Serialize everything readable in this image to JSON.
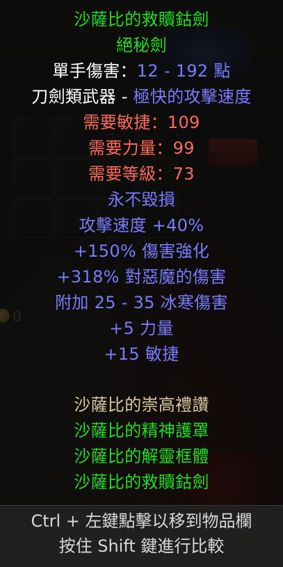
{
  "background": {
    "gold_count": "0"
  },
  "tooltip": {
    "item_name": "沙薩比的救贖鈷劍",
    "base_type": "絕秘劍",
    "damage_label": "單手傷害：",
    "damage_value": "12 - 192 點",
    "weapon_class": "刀劍類武器 - ",
    "attack_speed_class": "極快的攻擊速度",
    "req_dex": "需要敏捷：109",
    "req_str": "需要力量：99",
    "req_level": "需要等級：73",
    "mods": [
      "永不毀損",
      "攻擊速度 +40%",
      "+150% 傷害強化",
      "+318% 對惡魔的傷害",
      "附加 25 - 35 冰寒傷害",
      "+5 力量",
      "+15 敏捷"
    ],
    "set_name": "沙薩比的崇高禮讚",
    "set_items": [
      "沙薩比的精神護罩",
      "沙薩比的解靈框體",
      "沙薩比的救贖鈷劍"
    ],
    "hint_ctrl": "Ctrl + 左鍵點擊以移到物品欄",
    "hint_shift": "按住 Shift 鍵進行比較"
  },
  "colors": {
    "set_green": "#22dd22",
    "magic_blue": "#7b7bff",
    "requirement_red": "#ff6a5c",
    "set_title_gold": "#d9c9a0"
  }
}
